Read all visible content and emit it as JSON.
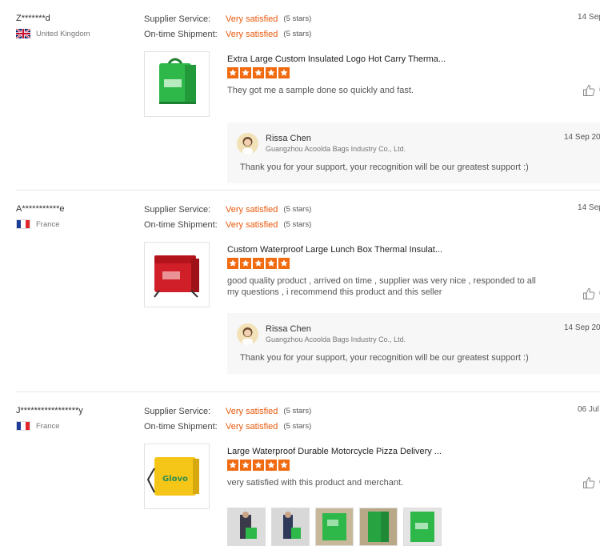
{
  "labels": {
    "supplier_service": "Supplier Service:",
    "ontime_shipment": "On-time Shipment:"
  },
  "reviews": [
    {
      "user": "Z*******d",
      "country": "United Kingdom",
      "flag": "uk-flag",
      "supplier_value": "Very satisfied",
      "supplier_stars": "(5 stars)",
      "shipment_value": "Very satisfied",
      "shipment_stars": "(5 stars)",
      "date": "14 Sep",
      "product_title": "Extra Large Custom Insulated Logo Hot Carry Therma...",
      "rating": 5,
      "comment": "They got me a sample done so quickly and fast.",
      "reply": {
        "name": "Rissa Chen",
        "company": "Guangzhou Acoolda Bags Industry Co., Ltd.",
        "date": "14 Sep 202",
        "text": "Thank you for your support, your recognition will be our greatest support :)"
      }
    },
    {
      "user": "A***********e",
      "country": "France",
      "flag": "france-flag",
      "supplier_value": "Very satisfied",
      "supplier_stars": "(5 stars)",
      "shipment_value": "Very satisfied",
      "shipment_stars": "(5 stars)",
      "date": "14 Sep",
      "product_title": "Custom Waterproof Large Lunch Box Thermal Insulat...",
      "rating": 5,
      "comment": "good quality product , arrived on time , supplier was very nice , responded to all my questions , i recommend this product and this seller",
      "reply": {
        "name": "Rissa Chen",
        "company": "Guangzhou Acoolda Bags Industry Co., Ltd.",
        "date": "14 Sep 202",
        "text": "Thank you for your support, your recognition will be our greatest support :)"
      }
    },
    {
      "user": "J*****************y",
      "country": "France",
      "flag": "france-flag",
      "supplier_value": "Very satisfied",
      "supplier_stars": "(5 stars)",
      "shipment_value": "Very satisfied",
      "shipment_stars": "(5 stars)",
      "date": "06 Jul",
      "product_title": "Large Waterproof Durable Motorcycle Pizza Delivery ...",
      "rating": 5,
      "comment": "very satisfied with this product and merchant.",
      "photos_count": 5
    }
  ],
  "colors": {
    "accent": "#e8590c",
    "star": "#f06a10",
    "reply_bg": "#f7f7f7"
  }
}
